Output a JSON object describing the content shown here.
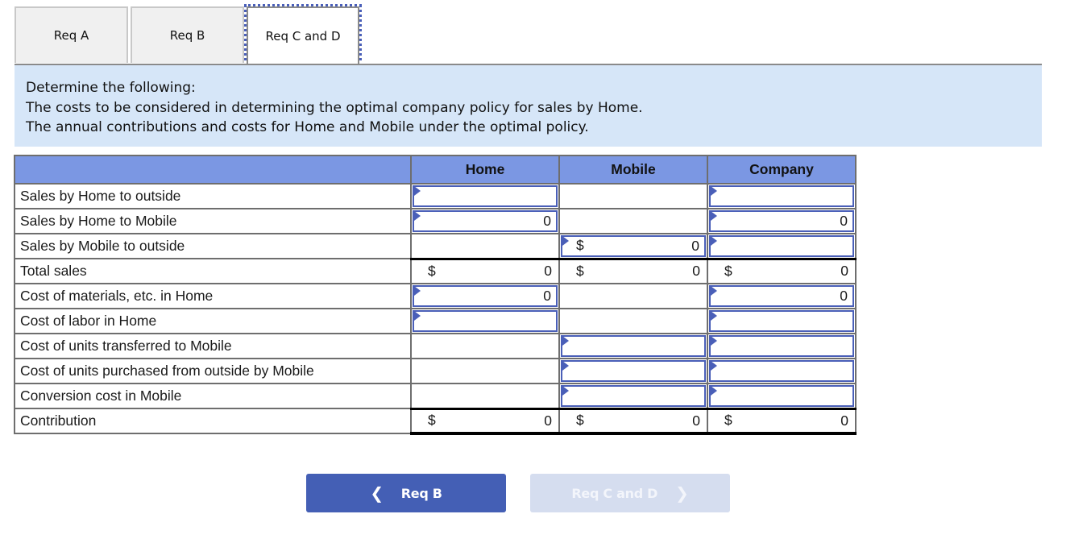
{
  "tabs": [
    {
      "label": "Req A",
      "active": false
    },
    {
      "label": "Req B",
      "active": false
    },
    {
      "label": "Req C and D",
      "active": true
    }
  ],
  "instructions": {
    "lines": [
      "Determine the following:",
      "The costs to be considered in determining the optimal company policy for sales by Home.",
      "The annual contributions and costs for Home and Mobile under the optimal policy."
    ]
  },
  "table": {
    "columns": [
      "Home",
      "Mobile",
      "Company"
    ],
    "rows": [
      {
        "label": "Sales by Home to outside",
        "cells": [
          {
            "input": true,
            "dollar": "",
            "value": ""
          },
          {
            "input": false,
            "dollar": "",
            "value": ""
          },
          {
            "input": true,
            "dollar": "",
            "value": ""
          }
        ]
      },
      {
        "label": "Sales by Home to Mobile",
        "cells": [
          {
            "input": true,
            "dollar": "",
            "value": "0"
          },
          {
            "input": false,
            "dollar": "",
            "value": ""
          },
          {
            "input": true,
            "dollar": "",
            "value": "0"
          }
        ]
      },
      {
        "label": "Sales by Mobile to outside",
        "cells": [
          {
            "input": false,
            "dollar": "",
            "value": ""
          },
          {
            "input": true,
            "dollar": "$",
            "value": "0"
          },
          {
            "input": true,
            "dollar": "",
            "value": ""
          }
        ]
      },
      {
        "label": "Total sales",
        "cells": [
          {
            "input": false,
            "dollar": "$",
            "value": "0"
          },
          {
            "input": false,
            "dollar": "$",
            "value": "0"
          },
          {
            "input": false,
            "dollar": "$",
            "value": "0"
          }
        ]
      },
      {
        "label": "Cost of materials, etc. in Home",
        "cells": [
          {
            "input": true,
            "dollar": "",
            "value": "0"
          },
          {
            "input": false,
            "dollar": "",
            "value": ""
          },
          {
            "input": true,
            "dollar": "",
            "value": "0"
          }
        ]
      },
      {
        "label": "Cost of labor in Home",
        "cells": [
          {
            "input": true,
            "dollar": "",
            "value": ""
          },
          {
            "input": false,
            "dollar": "",
            "value": ""
          },
          {
            "input": true,
            "dollar": "",
            "value": ""
          }
        ]
      },
      {
        "label": "Cost of units transferred to Mobile",
        "cells": [
          {
            "input": false,
            "dollar": "",
            "value": ""
          },
          {
            "input": true,
            "dollar": "",
            "value": ""
          },
          {
            "input": true,
            "dollar": "",
            "value": ""
          }
        ]
      },
      {
        "label": "Cost of units purchased from outside by Mobile",
        "cells": [
          {
            "input": false,
            "dollar": "",
            "value": ""
          },
          {
            "input": true,
            "dollar": "",
            "value": ""
          },
          {
            "input": true,
            "dollar": "",
            "value": ""
          }
        ]
      },
      {
        "label": "Conversion cost in Mobile",
        "cells": [
          {
            "input": false,
            "dollar": "",
            "value": ""
          },
          {
            "input": true,
            "dollar": "",
            "value": ""
          },
          {
            "input": true,
            "dollar": "",
            "value": ""
          }
        ]
      },
      {
        "label": "Contribution",
        "cells": [
          {
            "input": false,
            "dollar": "$",
            "value": "0"
          },
          {
            "input": false,
            "dollar": "$",
            "value": "0"
          },
          {
            "input": false,
            "dollar": "$",
            "value": "0"
          }
        ]
      }
    ]
  },
  "nav": {
    "prev_label": "Req B",
    "prev_icon": "chevron-left-icon",
    "next_label": "Req C and D",
    "next_icon": "chevron-right-icon",
    "next_disabled": true
  },
  "colors": {
    "accent": "#445fb5",
    "header_bg": "#7b97e3",
    "instructions_bg": "#d6e6f8",
    "disabled_button": "#d5ddef"
  }
}
